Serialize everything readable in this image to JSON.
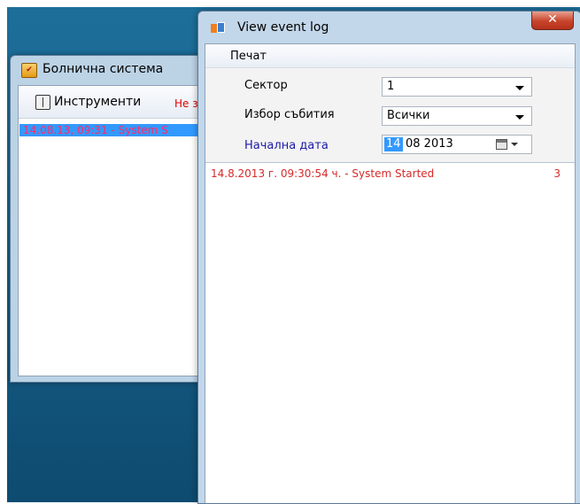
{
  "back_window": {
    "title": "Болнична система",
    "toolbar": {
      "tools_label": "Инструменти",
      "warning_text": "Не за"
    },
    "log_items": [
      "14.08.13, 09:31 - System S"
    ]
  },
  "front_window": {
    "title": "View event log",
    "close_symbol": "✕",
    "menu": {
      "print": "Печат"
    },
    "form": {
      "sector": {
        "label": "Сектор",
        "value": "1"
      },
      "event_select": {
        "label": "Избор събития",
        "value": "Всички"
      },
      "start_date": {
        "label": "Начална дата",
        "day": "14",
        "rest": "08 2013"
      }
    },
    "log": [
      {
        "text": "14.8.2013 г. 09:30:54 ч. - System Started",
        "count": "3"
      }
    ]
  },
  "icons": {
    "back_app_icon": "app-icon",
    "tools_icon": "antenna-icon",
    "front_app_icon": "window-icon",
    "calendar_icon": "calendar-icon"
  },
  "colors": {
    "desktop": "#175f88",
    "selection": "#3399ff",
    "log_text": "#d62a2a",
    "label_blue": "#1c1ca8"
  }
}
